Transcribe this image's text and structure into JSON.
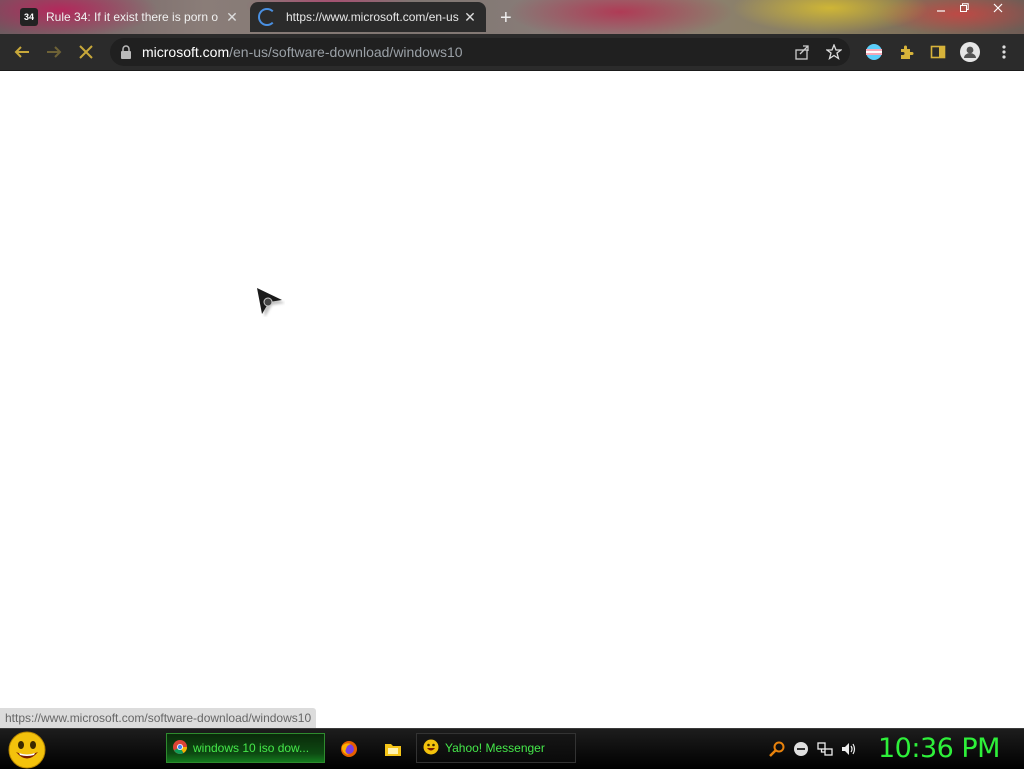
{
  "browser": {
    "tabs": [
      {
        "badge": "34",
        "title": "Rule 34: If it exist there is porn o",
        "state": "inactive"
      },
      {
        "title": "https://www.microsoft.com/en-us",
        "state": "active",
        "loading": true
      }
    ],
    "new_tab_label": "+",
    "address": {
      "host": "microsoft.com",
      "path": "/en-us/software-download/windows10"
    },
    "status_url": "https://www.microsoft.com/software-download/windows10"
  },
  "taskbar": {
    "tasks": [
      {
        "icon": "chrome-icon",
        "label": "windows 10 iso dow...",
        "active": true
      },
      {
        "icon": "yahoo-messenger-icon",
        "label": "Yahoo! Messenger",
        "active": false
      }
    ],
    "quick_launch": [
      "firefox-icon",
      "folder-icon"
    ],
    "tray_icons": [
      "search-icon",
      "minus-circle-icon",
      "network-icon",
      "volume-icon"
    ],
    "clock": "10:36 PM"
  },
  "colors": {
    "toolbar_bg": "#2b2b2b",
    "taskbar_text": "#45e84a",
    "clock": "#2ef03a",
    "spinner": "#4a90e2"
  }
}
